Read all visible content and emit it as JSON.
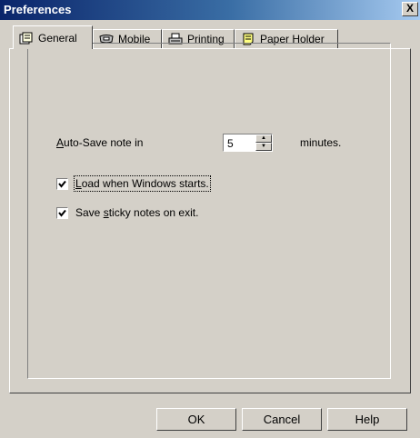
{
  "window": {
    "title": "Preferences",
    "close_label": "X"
  },
  "tabs": [
    {
      "label": "General",
      "icon": "settings-sheet-icon",
      "active": true
    },
    {
      "label": "Mobile",
      "icon": "mobile-device-icon",
      "active": false
    },
    {
      "label": "Printing",
      "icon": "printer-icon",
      "active": false
    },
    {
      "label": "Paper Holder",
      "icon": "paper-holder-icon",
      "active": false
    }
  ],
  "general": {
    "autosave": {
      "label_accel": "A",
      "label_rest": "uto-Save note in",
      "value": "5",
      "suffix": "minutes."
    },
    "load_on_start": {
      "label_accel": "L",
      "label_rest": "oad when Windows starts.",
      "checked": true
    },
    "save_on_exit": {
      "label_before": "Save ",
      "label_accel": "s",
      "label_after": "ticky notes on exit.",
      "checked": true
    }
  },
  "buttons": {
    "ok": "OK",
    "cancel": "Cancel",
    "help": "Help"
  },
  "colors": {
    "dialog_bg": "#d4d0c8",
    "title_start": "#0a246a",
    "title_end": "#a6caf0"
  }
}
